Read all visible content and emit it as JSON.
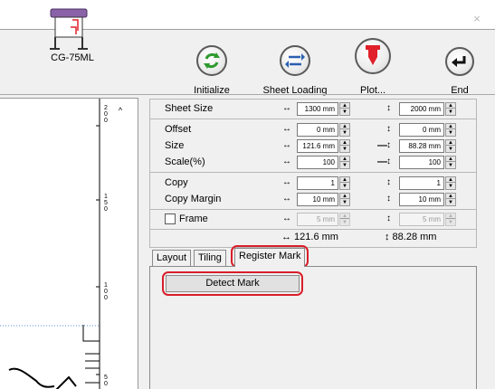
{
  "window": {
    "close_glyph": "×"
  },
  "toolbar": {
    "device_name": "CG-75ML",
    "initialize": "Initialize",
    "sheet_loading": "Sheet Loading",
    "plot": "Plot...",
    "end": "End",
    "icons": [
      "plotter-icon",
      "refresh-icon",
      "swap-arrows-icon",
      "plot-icon",
      "return-icon"
    ]
  },
  "preview": {
    "ruler_labels": [
      [
        "2",
        "0",
        "0"
      ],
      [
        "1",
        "5",
        "0"
      ],
      [
        "1",
        "0",
        "0"
      ],
      [
        "5",
        "0"
      ]
    ]
  },
  "settings": {
    "sheet_size": {
      "label": "Sheet Size",
      "h": "1300 mm",
      "v": "2000 mm"
    },
    "offset": {
      "label": "Offset",
      "h": "0 mm",
      "v": "0 mm"
    },
    "size": {
      "label": "Size",
      "h": "121.6 mm",
      "v": "88.28 mm"
    },
    "scale": {
      "label": "Scale(%)",
      "h": "100",
      "v": "100"
    },
    "copy": {
      "label": "Copy",
      "h": "1",
      "v": "1"
    },
    "copy_margin": {
      "label": "Copy Margin",
      "h": "10 mm",
      "v": "10 mm"
    },
    "frame": {
      "label": "Frame",
      "h": "5 mm",
      "v": "5 mm",
      "checked": false
    },
    "result_h": "↔ 121.6 mm",
    "result_v": "↕ 88.28 mm",
    "arrow_h": "↔",
    "arrow_v": "↕",
    "link_dash": "—"
  },
  "tabs": {
    "items": [
      "Layout",
      "Tiling",
      "Register Mark"
    ],
    "active": "Register Mark"
  },
  "register_mark": {
    "detect_button": "Detect Mark"
  },
  "colors": {
    "highlight_ring": "#d81e2a",
    "plot_icon": "#e0202a",
    "refresh_icon": "#2e9a2e",
    "swap_icon": "#2a5fb0"
  }
}
